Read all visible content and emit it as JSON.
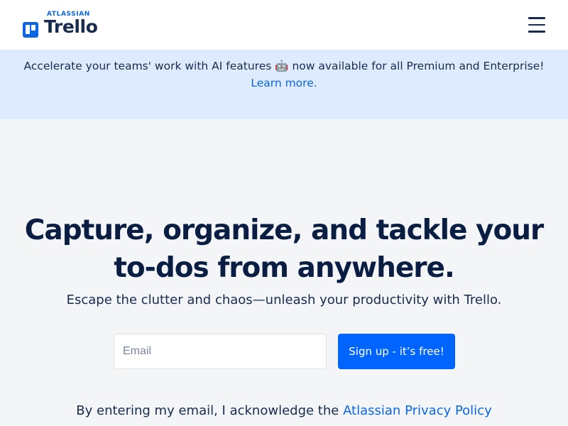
{
  "header": {
    "logo": {
      "brand_small": "ATLASSIAN",
      "product": "Trello"
    },
    "menu_icon": "hamburger-menu-icon"
  },
  "banner": {
    "text": "Accelerate your teams' work with AI features 🤖 now available for all Premium and Enterprise!",
    "link_label": "Learn more."
  },
  "hero": {
    "title": "Capture, organize, and tackle your to-dos from anywhere.",
    "subtitle": "Escape the clutter and chaos—unleash your productivity with Trello."
  },
  "signup": {
    "email_placeholder": "Email",
    "button_label": "Sign up - it’s free!"
  },
  "legal": {
    "prefix": "By entering my email, I acknowledge the ",
    "link_label": "Atlassian Privacy Policy"
  },
  "colors": {
    "brand_blue": "#0c66e4",
    "cta_blue": "#0065ff",
    "banner_bg": "#deebff",
    "page_bg": "#f4f5f7",
    "heading": "#091e42"
  }
}
